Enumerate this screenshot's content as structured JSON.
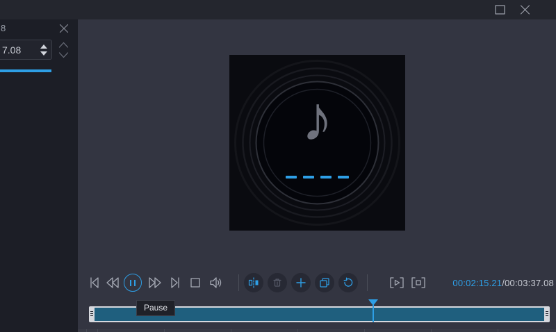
{
  "titlebar": {
    "icons": {
      "maximize": "maximize-window",
      "close": "close-window"
    }
  },
  "left_panel": {
    "clipped_text": "8",
    "time_spinner": {
      "value": "7.08"
    },
    "icons": {
      "close": "close-panel",
      "chevron_up": "spin-up",
      "chevron_down": "spin-down"
    },
    "indicator_color": "#2e9fe6"
  },
  "album": {
    "music_note_glyph": "♪",
    "loading_dashes": 4,
    "dash_color": "#2e9fe6"
  },
  "transport": {
    "tooltip": "Pause",
    "time_current": "00:02:15.21",
    "time_divider": "/",
    "time_total": "00:03:37.08",
    "icons": {
      "skip_back": "skip-to-start",
      "rewind": "rewind",
      "pause": "pause (active)",
      "fast_forward": "fast-forward",
      "skip_forward": "skip-to-end",
      "stop": "stop",
      "volume": "volume",
      "split": "split-clip",
      "delete": "delete-clip (disabled)",
      "add": "add-segment",
      "copy": "copy-segment",
      "reset": "reset",
      "play_selection": "play-selection",
      "stop_selection": "stop-selection"
    }
  },
  "timeline": {
    "playhead_style": "left:61.7%",
    "fill_color": "#1f5f7e"
  },
  "colors": {
    "accent_blue": "#2e9fe6",
    "background_main": "#333541",
    "background_panel": "#1c1e26",
    "background_titlebar": "#24262e"
  }
}
